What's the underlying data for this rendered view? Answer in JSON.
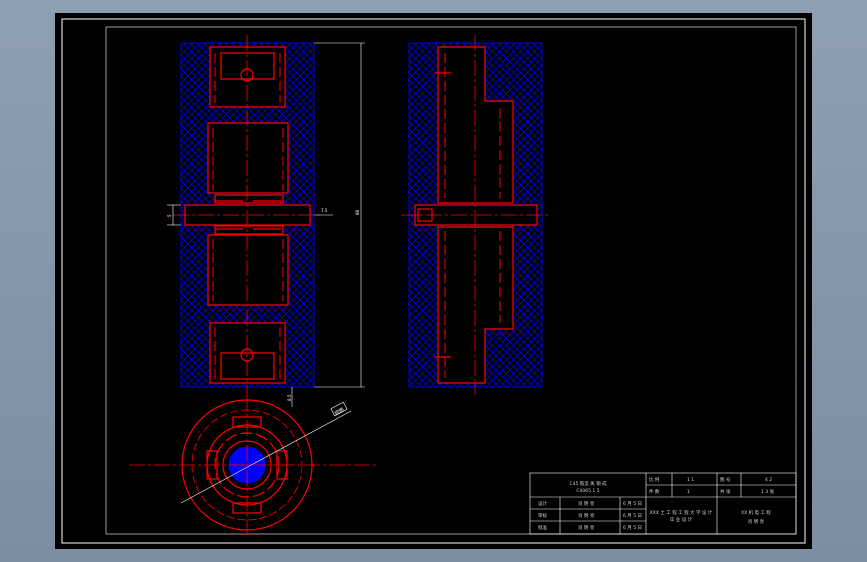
{
  "colors": {
    "background": "#000000",
    "frame": "#ffffff",
    "hatch": "#0000ff",
    "outline": "#ff0000",
    "dimension": "#ffffff",
    "title_block_text": "#d0d0d0"
  },
  "dimensions": {
    "left_gap": "5",
    "right_gap": "7.5",
    "overall_height": "88",
    "bottom_offset": "8.5"
  },
  "annotation": {
    "callout": "视图"
  },
  "title_block": {
    "material": "C45 锻造 离 钢 成",
    "standard": "C4065 1 5",
    "scale_label": "比 例",
    "scale_value": "1 1",
    "sheet_label": "图 号",
    "sheet_value": "4 2",
    "qty_label": "件 数",
    "qty_value": "1",
    "weight_label": "共 张",
    "weight_value": "1 3 张",
    "rows": [
      {
        "role": "设计",
        "name": "肖 明 亮",
        "date": "6 月 5 日"
      },
      {
        "role": "审核",
        "name": "肖 明 亮",
        "date": "6 月 5 日"
      },
      {
        "role": "批准",
        "name": "肖 明 亮",
        "date": "6 月 5 日"
      }
    ],
    "project": "XXX 土 工 程 工 程 大 学 设 计",
    "project_sub": "毕 业 设 计",
    "company": "XX 机 电 工 程",
    "company_sub": "肖 明 亮"
  }
}
